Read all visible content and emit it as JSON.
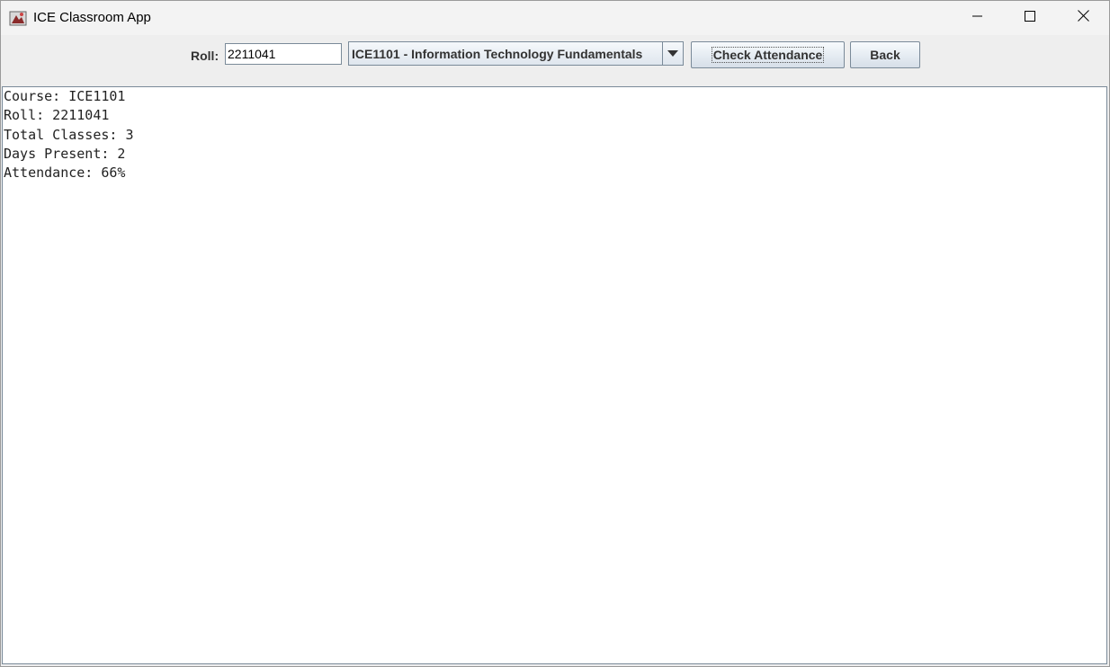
{
  "window": {
    "title": "ICE Classroom App",
    "controls": {
      "minimize_icon": "minimize-icon",
      "maximize_icon": "maximize-icon",
      "close_icon": "close-icon"
    }
  },
  "toolbar": {
    "roll_label": "Roll:",
    "roll_value": "2211041",
    "course_selected": "ICE1101 - Information Technology Fundamentals",
    "check_attendance_label": "Check Attendance",
    "back_label": "Back"
  },
  "output": {
    "lines": [
      "Course: ICE1101",
      "Roll: 2211041",
      "Total Classes: 3",
      "Days Present: 2",
      "Attendance: 66%"
    ]
  },
  "colors": {
    "toolbar_bg": "#eeeeee",
    "button_border": "#7a8a99",
    "text_area_bg": "#ffffff"
  }
}
